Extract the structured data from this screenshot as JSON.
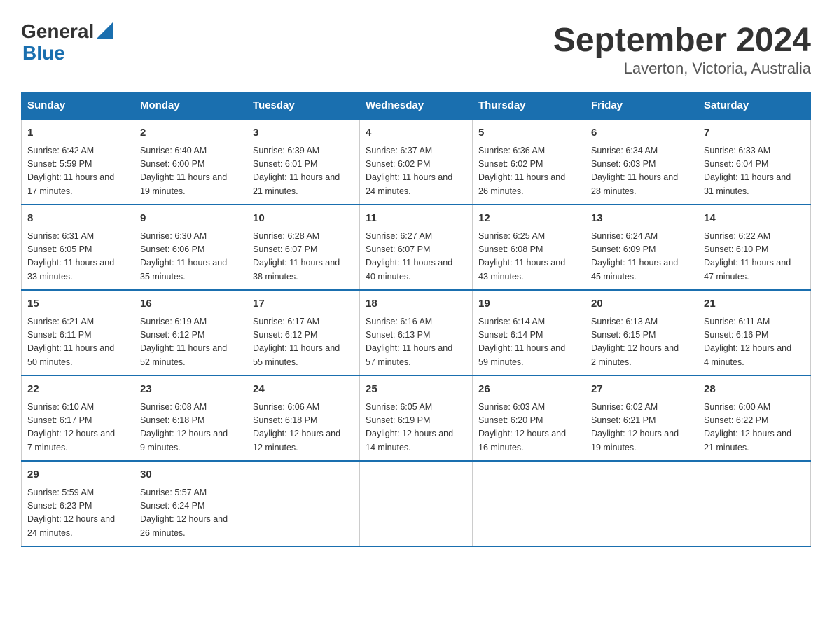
{
  "header": {
    "logo_general": "General",
    "logo_blue": "Blue",
    "month_title": "September 2024",
    "location": "Laverton, Victoria, Australia"
  },
  "days_of_week": [
    "Sunday",
    "Monday",
    "Tuesday",
    "Wednesday",
    "Thursday",
    "Friday",
    "Saturday"
  ],
  "weeks": [
    [
      {
        "day": "1",
        "sunrise": "6:42 AM",
        "sunset": "5:59 PM",
        "daylight": "11 hours and 17 minutes."
      },
      {
        "day": "2",
        "sunrise": "6:40 AM",
        "sunset": "6:00 PM",
        "daylight": "11 hours and 19 minutes."
      },
      {
        "day": "3",
        "sunrise": "6:39 AM",
        "sunset": "6:01 PM",
        "daylight": "11 hours and 21 minutes."
      },
      {
        "day": "4",
        "sunrise": "6:37 AM",
        "sunset": "6:02 PM",
        "daylight": "11 hours and 24 minutes."
      },
      {
        "day": "5",
        "sunrise": "6:36 AM",
        "sunset": "6:02 PM",
        "daylight": "11 hours and 26 minutes."
      },
      {
        "day": "6",
        "sunrise": "6:34 AM",
        "sunset": "6:03 PM",
        "daylight": "11 hours and 28 minutes."
      },
      {
        "day": "7",
        "sunrise": "6:33 AM",
        "sunset": "6:04 PM",
        "daylight": "11 hours and 31 minutes."
      }
    ],
    [
      {
        "day": "8",
        "sunrise": "6:31 AM",
        "sunset": "6:05 PM",
        "daylight": "11 hours and 33 minutes."
      },
      {
        "day": "9",
        "sunrise": "6:30 AM",
        "sunset": "6:06 PM",
        "daylight": "11 hours and 35 minutes."
      },
      {
        "day": "10",
        "sunrise": "6:28 AM",
        "sunset": "6:07 PM",
        "daylight": "11 hours and 38 minutes."
      },
      {
        "day": "11",
        "sunrise": "6:27 AM",
        "sunset": "6:07 PM",
        "daylight": "11 hours and 40 minutes."
      },
      {
        "day": "12",
        "sunrise": "6:25 AM",
        "sunset": "6:08 PM",
        "daylight": "11 hours and 43 minutes."
      },
      {
        "day": "13",
        "sunrise": "6:24 AM",
        "sunset": "6:09 PM",
        "daylight": "11 hours and 45 minutes."
      },
      {
        "day": "14",
        "sunrise": "6:22 AM",
        "sunset": "6:10 PM",
        "daylight": "11 hours and 47 minutes."
      }
    ],
    [
      {
        "day": "15",
        "sunrise": "6:21 AM",
        "sunset": "6:11 PM",
        "daylight": "11 hours and 50 minutes."
      },
      {
        "day": "16",
        "sunrise": "6:19 AM",
        "sunset": "6:12 PM",
        "daylight": "11 hours and 52 minutes."
      },
      {
        "day": "17",
        "sunrise": "6:17 AM",
        "sunset": "6:12 PM",
        "daylight": "11 hours and 55 minutes."
      },
      {
        "day": "18",
        "sunrise": "6:16 AM",
        "sunset": "6:13 PM",
        "daylight": "11 hours and 57 minutes."
      },
      {
        "day": "19",
        "sunrise": "6:14 AM",
        "sunset": "6:14 PM",
        "daylight": "11 hours and 59 minutes."
      },
      {
        "day": "20",
        "sunrise": "6:13 AM",
        "sunset": "6:15 PM",
        "daylight": "12 hours and 2 minutes."
      },
      {
        "day": "21",
        "sunrise": "6:11 AM",
        "sunset": "6:16 PM",
        "daylight": "12 hours and 4 minutes."
      }
    ],
    [
      {
        "day": "22",
        "sunrise": "6:10 AM",
        "sunset": "6:17 PM",
        "daylight": "12 hours and 7 minutes."
      },
      {
        "day": "23",
        "sunrise": "6:08 AM",
        "sunset": "6:18 PM",
        "daylight": "12 hours and 9 minutes."
      },
      {
        "day": "24",
        "sunrise": "6:06 AM",
        "sunset": "6:18 PM",
        "daylight": "12 hours and 12 minutes."
      },
      {
        "day": "25",
        "sunrise": "6:05 AM",
        "sunset": "6:19 PM",
        "daylight": "12 hours and 14 minutes."
      },
      {
        "day": "26",
        "sunrise": "6:03 AM",
        "sunset": "6:20 PM",
        "daylight": "12 hours and 16 minutes."
      },
      {
        "day": "27",
        "sunrise": "6:02 AM",
        "sunset": "6:21 PM",
        "daylight": "12 hours and 19 minutes."
      },
      {
        "day": "28",
        "sunrise": "6:00 AM",
        "sunset": "6:22 PM",
        "daylight": "12 hours and 21 minutes."
      }
    ],
    [
      {
        "day": "29",
        "sunrise": "5:59 AM",
        "sunset": "6:23 PM",
        "daylight": "12 hours and 24 minutes."
      },
      {
        "day": "30",
        "sunrise": "5:57 AM",
        "sunset": "6:24 PM",
        "daylight": "12 hours and 26 minutes."
      },
      null,
      null,
      null,
      null,
      null
    ]
  ],
  "labels": {
    "sunrise": "Sunrise:",
    "sunset": "Sunset:",
    "daylight": "Daylight:"
  }
}
